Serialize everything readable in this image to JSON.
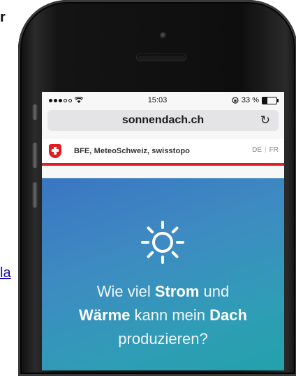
{
  "page_edge": {
    "heading_fragment": "r",
    "link_fragment": "la"
  },
  "status_bar": {
    "time": "15:03",
    "battery": "33 %",
    "battery_level": 0.33
  },
  "browser": {
    "url": "sonnendach.ch",
    "reload_icon": "reload-icon"
  },
  "site_header": {
    "agencies": "BFE, MeteoSchweiz, swisstopo",
    "lang_de": "DE",
    "lang_fr": "FR",
    "accent_color": "#e21c23"
  },
  "hero": {
    "line1_a": "Wie viel ",
    "line1_b": "Strom",
    "line1_c": " und",
    "line2_a": "Wärme",
    "line2_b": " kann mein ",
    "line2_c": "Dach",
    "line3": "produzieren?",
    "icon": "sun-icon"
  }
}
